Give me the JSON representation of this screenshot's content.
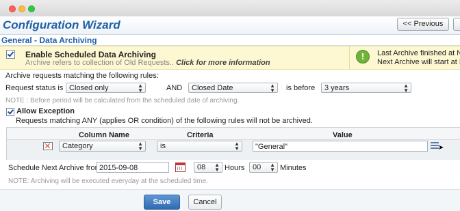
{
  "header": {
    "title": "Configuration Wizard",
    "previous_label": "<< Previous"
  },
  "section": {
    "title": "General - Data Archiving"
  },
  "banner": {
    "title": "Enable Scheduled Data Archiving",
    "subtitle": "Archive refers to collection of Old Requests..",
    "link": "Click for more information",
    "enabled": true
  },
  "status": {
    "last_archive": "Last Archive finished at N/A",
    "next_archive": "Next Archive will start at N/A"
  },
  "rules": {
    "heading": "Archive requests matching the following rules:",
    "request_status_label": "Request status is",
    "request_status_value": "Closed only",
    "and_label": "AND",
    "date_field_value": "Closed Date",
    "is_before_label": "is before",
    "period_value": "3 years",
    "note": "NOTE : Before period will be calculated from the scheduled date of archiving."
  },
  "exception": {
    "label": "Allow Exception",
    "checked": true,
    "description": "Requests matching ANY (applies OR condition) of the following rules will not be archived.",
    "columns": [
      "Column Name",
      "Criteria",
      "Value"
    ],
    "row": {
      "column": "Category",
      "criteria": "is",
      "value": "\"General\""
    }
  },
  "schedule": {
    "label": "Schedule Next Archive from",
    "date": "2015-09-08",
    "hours_value": "08",
    "hours_label": "Hours",
    "minutes_value": "00",
    "minutes_label": "Minutes",
    "note": "NOTE: Archiving will be executed everyday at the scheduled time."
  },
  "buttons": {
    "save": "Save",
    "cancel": "Cancel"
  },
  "colors": {
    "accent": "#1f5fa6",
    "banner_bg": "#fdf8d2",
    "save_button": "#2f6bb2",
    "ok_icon": "#6fb33b"
  }
}
